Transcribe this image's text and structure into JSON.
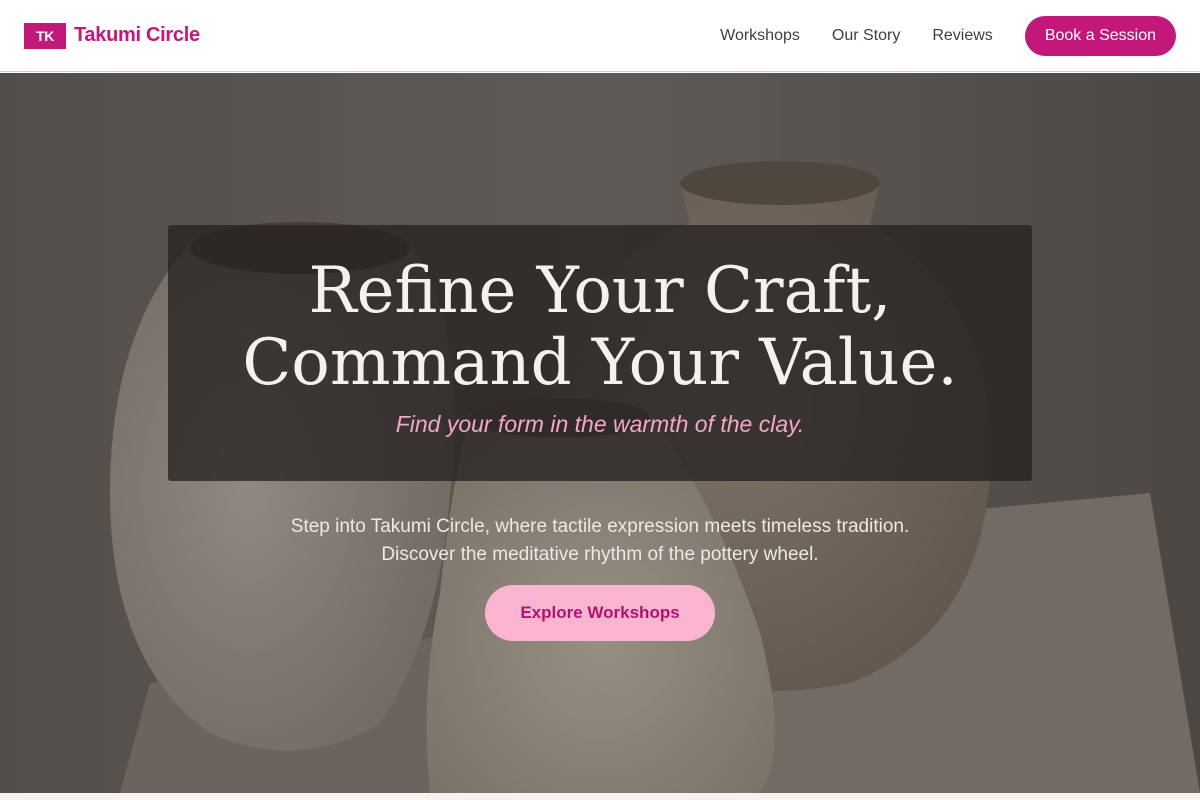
{
  "header": {
    "logo_mark": "TK",
    "brand_name": "Takumi Circle",
    "nav": [
      {
        "label": "Workshops"
      },
      {
        "label": "Our Story"
      },
      {
        "label": "Reviews"
      }
    ],
    "cta_label": "Book a Session"
  },
  "hero": {
    "headline_line1": "Refine Your Craft,",
    "headline_line2": "Command Your Value.",
    "tagline": "Find your form in the warmth of the clay.",
    "description": "Step into Takumi Circle, where tactile expression meets timeless tradition. Discover the meditative rhythm of the pottery wheel.",
    "cta_label": "Explore Workshops",
    "background_image": "pottery-vases-photo"
  },
  "colors": {
    "brand": "#c2187a",
    "cta_light": "#f9b5cf",
    "tagline": "#f2a7c8",
    "nav_text": "#3a3f4a"
  }
}
